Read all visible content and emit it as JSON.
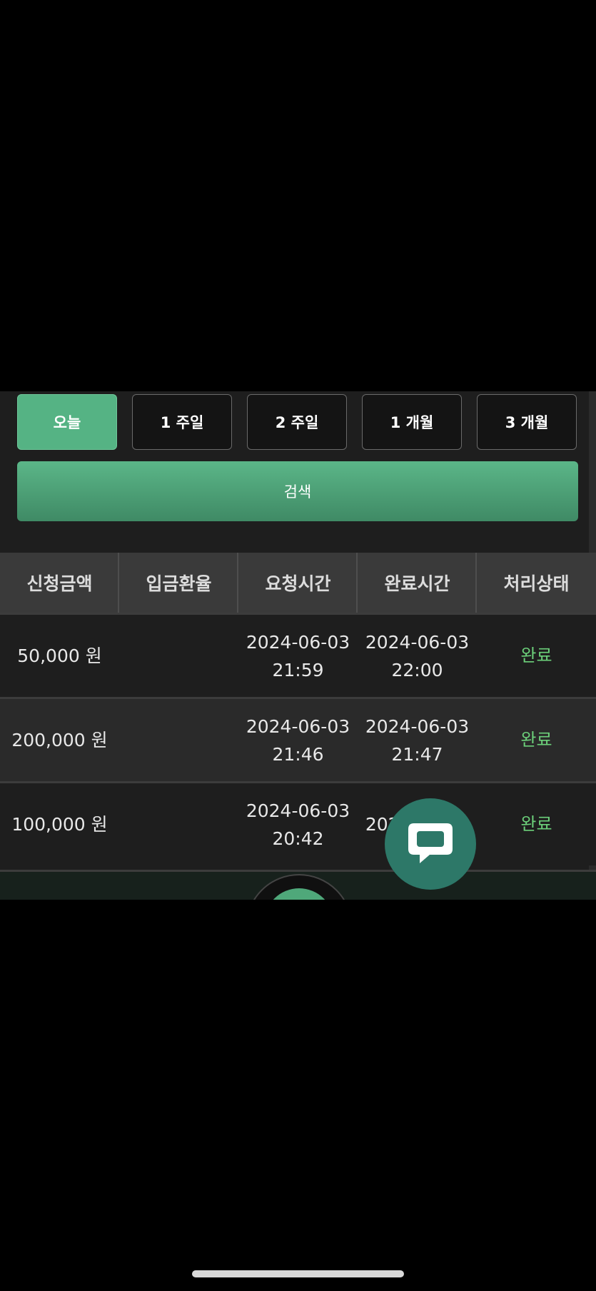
{
  "period_buttons": [
    {
      "label": "오늘",
      "active": true
    },
    {
      "label": "1 주일",
      "active": false
    },
    {
      "label": "2 주일",
      "active": false
    },
    {
      "label": "1 개월",
      "active": false
    },
    {
      "label": "3 개월",
      "active": false
    }
  ],
  "search_label": "검색",
  "table": {
    "headers": [
      "신청금액",
      "입금환율",
      "요청시간",
      "완료시간",
      "처리상태"
    ],
    "rows": [
      {
        "amount": "50,000 원",
        "rate": "",
        "request_date": "2024-06-03",
        "request_time": "21:59",
        "complete_date": "2024-06-03",
        "complete_time": "22:00",
        "status": "완료"
      },
      {
        "amount": "200,000 원",
        "rate": "",
        "request_date": "2024-06-03",
        "request_time": "21:46",
        "complete_date": "2024-06-03",
        "complete_time": "21:47",
        "status": "완료"
      },
      {
        "amount": "100,000 원",
        "rate": "",
        "request_date": "2024-06-03",
        "request_time": "20:42",
        "complete_date": "2024-06-03",
        "complete_time": "",
        "status": "완료"
      }
    ]
  },
  "colors": {
    "accent": "#55b384",
    "status_done": "#6cd07a",
    "chat_fab": "#2d7868"
  },
  "icons": {
    "chat": "chat-bubble-icon"
  }
}
